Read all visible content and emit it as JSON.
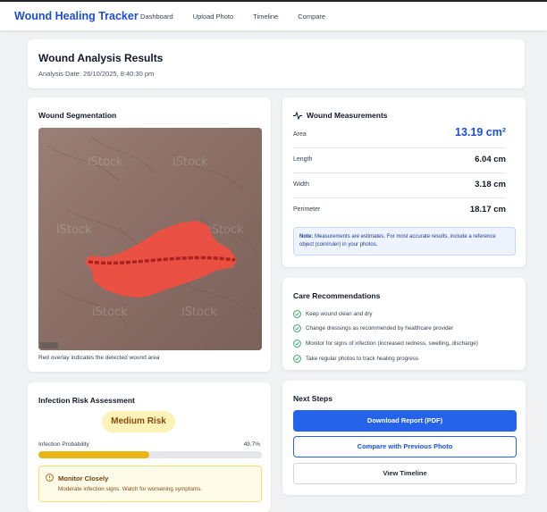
{
  "app": {
    "title": "Wound Healing Tracker",
    "nav": [
      "Dashboard",
      "Upload Photo",
      "Timeline",
      "Compare"
    ]
  },
  "results": {
    "title": "Wound Analysis Results",
    "date": "Analysis Date: 26/10/2025, 8:40:30 pm"
  },
  "segmentation": {
    "title": "Wound Segmentation",
    "caption": "Red overlay indicates the detected wound area",
    "image_watermark": "iStock"
  },
  "measurements": {
    "title": "Wound Measurements",
    "icon": "activity-icon",
    "rows": [
      {
        "label": "Area",
        "value": "13.19 cm²"
      },
      {
        "label": "Length",
        "value": "6.04 cm"
      },
      {
        "label": "Width",
        "value": "3.18 cm"
      },
      {
        "label": "Perimeter",
        "value": "18.17 cm"
      }
    ],
    "note_label": "Note:",
    "note_text": " Measurements are estimates. For most accurate results, include a reference object (coin/ruler) in your photos."
  },
  "care": {
    "title": "Care Recommendations",
    "items": [
      "Keep wound clean and dry",
      "Change dressings as recommended by healthcare provider",
      "Monitor for signs of infection (increased redness, swelling, discharge)",
      "Take regular photos to track healing progress"
    ]
  },
  "infection": {
    "title": "Infection Risk Assessment",
    "risk_label": "Medium Risk",
    "probability_label": "Infection Probability",
    "probability_text": "49.7%",
    "probability": 0.497,
    "alert_title": "Monitor Closely",
    "alert_text": "Moderate infection signs. Watch for worsening symptoms."
  },
  "next_steps": {
    "title": "Next Steps",
    "download": "Download Report (PDF)",
    "compare": "Compare with Previous Photo",
    "timeline": "View Timeline"
  },
  "colors": {
    "primary": "#2563eb",
    "risk_fill": "#e8b515",
    "check": "#22a05a"
  }
}
